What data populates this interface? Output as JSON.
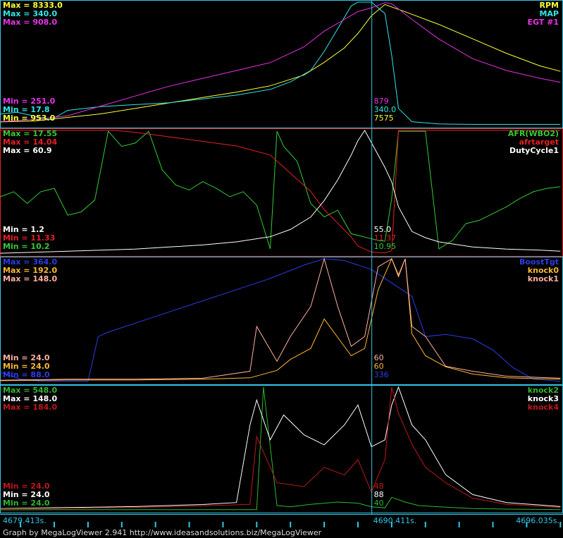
{
  "chart_data": [
    {
      "type": "line",
      "panel": 1,
      "legend": [
        {
          "name": "RPM",
          "color": "#ffff33"
        },
        {
          "name": "MAP",
          "color": "#33e6e6"
        },
        {
          "name": "EGT #1",
          "color": "#e633e6"
        }
      ],
      "max_labels": [
        "Max = 8333.0",
        "Max = 340.0",
        "Max = 908.0"
      ],
      "min_labels": [
        "Min = 251.0",
        "Min = 17.8",
        "Min = 953.0"
      ],
      "cursor_values": [
        "879",
        "340.0",
        "7575"
      ],
      "series": [
        {
          "name": "RPM",
          "color": "#ffff33",
          "x": [
            4679.4,
            4680.4,
            4681.4,
            4682.4,
            4683.4,
            4684.4,
            4685.4,
            4686.4,
            4687.4,
            4688.4,
            4689.0,
            4689.6,
            4690.0,
            4690.4,
            4690.8,
            4691.4,
            4692.4,
            4693.4,
            4694.4,
            4695.4,
            4696.0
          ],
          "y": [
            1700,
            1750,
            1950,
            2150,
            2450,
            2750,
            3050,
            3350,
            3700,
            4300,
            5000,
            5800,
            6600,
            7575,
            8200,
            7800,
            7100,
            6300,
            5500,
            4800,
            4500
          ]
        },
        {
          "name": "MAP",
          "color": "#33e6e6",
          "x": [
            4679.4,
            4679.9,
            4680.4,
            4680.9,
            4681.4,
            4682.4,
            4683.4,
            4684.4,
            4685.4,
            4686.4,
            4687.4,
            4688.0,
            4688.6,
            4689.0,
            4689.4,
            4689.8,
            4690.0,
            4690.4,
            4690.8,
            4691.0,
            4691.2,
            4691.6,
            4692.4,
            4693.4,
            4694.4,
            4695.4,
            4696.0
          ],
          "y": [
            45,
            50,
            40,
            30,
            55,
            65,
            70,
            75,
            85,
            95,
            110,
            130,
            160,
            210,
            270,
            330,
            340,
            340,
            310,
            200,
            60,
            25,
            19,
            18,
            18,
            18,
            18
          ]
        },
        {
          "name": "EGT #1",
          "color": "#e633e6",
          "x": [
            4679.4,
            4680.4,
            4681.4,
            4682.4,
            4683.4,
            4684.4,
            4685.4,
            4686.4,
            4687.4,
            4688.4,
            4689.0,
            4689.6,
            4690.0,
            4690.4,
            4690.8,
            4691.0,
            4691.6,
            4692.4,
            4693.4,
            4694.4,
            4695.4,
            4696.0
          ],
          "y": [
            300,
            310,
            330,
            380,
            430,
            480,
            520,
            560,
            600,
            680,
            760,
            820,
            860,
            879,
            905,
            900,
            820,
            720,
            620,
            560,
            520,
            500
          ]
        }
      ]
    },
    {
      "type": "line",
      "panel": 2,
      "legend": [
        {
          "name": "AFR(WBO2)",
          "color": "#33cc33"
        },
        {
          "name": "afrtarget",
          "color": "#e62020"
        },
        {
          "name": "DutyCycle1",
          "color": "#ffffff"
        }
      ],
      "max_labels": [
        "Max = 17.55",
        "Max = 14.04",
        "Max = 60.9"
      ],
      "min_labels": [
        "Min = 1.2",
        "Min = 11.33",
        "Min = 10.2"
      ],
      "cursor_values": [
        "55.0",
        "11.37",
        "10.95"
      ],
      "series": [
        {
          "name": "AFR(WBO2)",
          "color": "#33cc33",
          "x": [
            4679.4,
            4679.8,
            4680.2,
            4680.6,
            4681.0,
            4681.4,
            4681.8,
            4682.2,
            4682.6,
            4683.0,
            4683.4,
            4683.8,
            4684.2,
            4684.6,
            4685.0,
            4685.4,
            4685.8,
            4686.2,
            4686.6,
            4687.0,
            4687.4,
            4687.6,
            4687.8,
            4688.2,
            4688.6,
            4689.0,
            4689.4,
            4689.8,
            4690.2,
            4690.6,
            4690.8,
            4691.0,
            4691.2,
            4691.6,
            4692.0,
            4692.4,
            4692.8,
            4693.2,
            4693.6,
            4694.0,
            4694.4,
            4694.8,
            4695.2,
            4695.6,
            4696.0
          ],
          "y": [
            13.6,
            13.9,
            13.2,
            13.9,
            14.1,
            12.5,
            12.7,
            13.4,
            17.5,
            16.6,
            16.8,
            17.5,
            15.2,
            14.3,
            14.0,
            14.5,
            14.1,
            13.6,
            13.9,
            13.1,
            10.5,
            17.5,
            16.6,
            15.7,
            13.2,
            12.4,
            12.8,
            11.4,
            11.2,
            11.0,
            10.95,
            13.5,
            17.5,
            17.5,
            17.5,
            10.5,
            11.0,
            12.0,
            12.2,
            12.6,
            13.0,
            13.5,
            13.9,
            14.1,
            14.2
          ]
        },
        {
          "name": "afrtarget",
          "color": "#e62020",
          "x": [
            4679.4,
            4680.4,
            4681.4,
            4682.4,
            4682.8,
            4683.4,
            4684.4,
            4685.4,
            4686.4,
            4687.4,
            4688.0,
            4688.6,
            4689.0,
            4689.4,
            4689.8,
            4690.0,
            4690.4,
            4690.8,
            4691.0,
            4691.2,
            4691.6,
            4692.4,
            4693.4,
            4694.4,
            4695.4,
            4696.0
          ],
          "y": [
            17.5,
            17.5,
            17.5,
            17.5,
            15.6,
            14.0,
            13.9,
            13.8,
            13.7,
            13.5,
            13.1,
            12.7,
            12.3,
            12.0,
            11.7,
            11.5,
            11.37,
            11.35,
            11.4,
            17.5,
            17.5,
            17.5,
            17.5,
            17.5,
            17.5,
            17.5
          ]
        },
        {
          "name": "DutyCycle1",
          "color": "#ffffff",
          "x": [
            4679.4,
            4680.4,
            4681.4,
            4682.4,
            4683.4,
            4684.4,
            4685.4,
            4686.4,
            4687.4,
            4688.0,
            4688.6,
            4689.0,
            4689.4,
            4689.8,
            4690.0,
            4690.2,
            4690.4,
            4690.8,
            4691.0,
            4691.2,
            4691.6,
            4692.0,
            4692.4,
            4693.4,
            4694.4,
            4695.4,
            4696.0
          ],
          "y": [
            1.5,
            2.0,
            2.5,
            3.0,
            3.5,
            4.5,
            5.5,
            7.0,
            9.5,
            13.0,
            19.0,
            27.0,
            37.0,
            49.0,
            56.0,
            60.9,
            55.0,
            43.0,
            36.0,
            24.0,
            12.0,
            9.0,
            7.0,
            4.5,
            3.5,
            3.0,
            2.5
          ]
        }
      ]
    },
    {
      "type": "line",
      "panel": 3,
      "legend": [
        {
          "name": "BoostTgt",
          "color": "#2a3de6"
        },
        {
          "name": "knock0",
          "color": "#ffb833"
        },
        {
          "name": "knock1",
          "color": "#ffb0a0"
        }
      ],
      "max_labels": [
        "Max = 364.0",
        "Max = 192.0",
        "Max = 148.0"
      ],
      "min_labels": [
        "Min = 24.0",
        "Min = 24.0",
        "Min = 88.0"
      ],
      "cursor_values": [
        "60",
        "60",
        "336"
      ],
      "series": [
        {
          "name": "BoostTgt",
          "color": "#2a3de6",
          "x": [
            4679.4,
            4680.0,
            4680.6,
            4681.2,
            4682.0,
            4682.3,
            4682.6,
            4683.4,
            4684.0,
            4684.6,
            4685.4,
            4686.4,
            4687.4,
            4688.4,
            4689.0,
            4689.6,
            4690.4,
            4690.8,
            4691.2,
            4691.6,
            4692.0,
            4692.6,
            4693.4,
            4694.0,
            4694.6,
            4695.2,
            4696.0
          ],
          "y": [
            110,
            95,
            90,
            90,
            90,
            190,
            200,
            220,
            235,
            250,
            270,
            295,
            320,
            350,
            364,
            360,
            340,
            320,
            300,
            280,
            190,
            195,
            185,
            160,
            120,
            95,
            90
          ]
        },
        {
          "name": "knock0",
          "color": "#ffb833",
          "x": [
            4679.4,
            4681.4,
            4683.4,
            4685.4,
            4686.8,
            4687.6,
            4688.0,
            4688.6,
            4689.0,
            4689.4,
            4689.8,
            4690.2,
            4690.6,
            4691.0,
            4691.2,
            4691.4,
            4691.6,
            4692.0,
            4692.6,
            4693.4,
            4694.4,
            4696.0
          ],
          "y": [
            26,
            27,
            27,
            28,
            30,
            40,
            55,
            70,
            110,
            85,
            60,
            70,
            150,
            192,
            170,
            192,
            90,
            60,
            45,
            35,
            30,
            28
          ]
        },
        {
          "name": "knock1",
          "color": "#ffb0a0",
          "x": [
            4679.4,
            4681.4,
            4683.4,
            4685.4,
            4686.8,
            4687.0,
            4687.6,
            4688.0,
            4688.6,
            4689.0,
            4689.4,
            4689.8,
            4690.2,
            4690.6,
            4691.0,
            4691.2,
            4691.4,
            4691.6,
            4692.0,
            4692.6,
            4693.4,
            4694.4,
            4696.0
          ],
          "y": [
            26,
            27,
            27,
            28,
            35,
            80,
            45,
            70,
            100,
            148,
            100,
            60,
            70,
            140,
            148,
            130,
            148,
            80,
            70,
            40,
            35,
            30,
            28
          ]
        }
      ]
    },
    {
      "type": "line",
      "panel": 4,
      "legend": [
        {
          "name": "knock2",
          "color": "#2db82d"
        },
        {
          "name": "knock3",
          "color": "#ffffff"
        },
        {
          "name": "knock4",
          "color": "#c01818"
        }
      ],
      "max_labels": [
        "Max = 548.0",
        "Max = 148.0",
        "Max = 184.0"
      ],
      "min_labels": [
        "Min = 24.0",
        "Min = 24.0",
        "Min = 24.0"
      ],
      "cursor_values": [
        "48",
        "88",
        "40"
      ],
      "series": [
        {
          "name": "knock2",
          "color": "#2db82d",
          "x": [
            4679.4,
            4681.4,
            4683.4,
            4685.4,
            4687.0,
            4687.2,
            4687.6,
            4688.0,
            4688.6,
            4689.4,
            4690.0,
            4690.4,
            4690.8,
            4691.0,
            4691.4,
            4691.8,
            4692.4,
            4693.4,
            4694.4,
            4696.0
          ],
          "y": [
            27,
            28,
            28,
            28,
            28,
            548,
            45,
            40,
            50,
            60,
            55,
            40,
            35,
            80,
            60,
            45,
            40,
            32,
            30,
            28
          ]
        },
        {
          "name": "knock3",
          "color": "#ffffff",
          "x": [
            4679.4,
            4681.4,
            4683.4,
            4685.4,
            4686.4,
            4686.8,
            4687.0,
            4687.4,
            4687.8,
            4688.4,
            4689.0,
            4689.6,
            4690.0,
            4690.4,
            4690.8,
            4691.0,
            4691.2,
            4691.6,
            4692.0,
            4692.6,
            4693.4,
            4694.4,
            4696.0
          ],
          "y": [
            26,
            27,
            28,
            30,
            32,
            110,
            135,
            95,
            120,
            100,
            90,
            110,
            130,
            88,
            95,
            130,
            148,
            110,
            95,
            60,
            40,
            32,
            28
          ]
        },
        {
          "name": "knock4",
          "color": "#c01818",
          "x": [
            4679.4,
            4681.4,
            4683.4,
            4685.4,
            4686.8,
            4687.0,
            4687.6,
            4688.4,
            4689.0,
            4689.6,
            4690.0,
            4690.4,
            4690.8,
            4691.0,
            4691.2,
            4691.6,
            4692.0,
            4692.6,
            4693.4,
            4694.4,
            4696.0
          ],
          "y": [
            26,
            27,
            28,
            30,
            32,
            120,
            60,
            55,
            80,
            70,
            90,
            48,
            90,
            184,
            150,
            110,
            80,
            60,
            40,
            32,
            28
          ]
        }
      ]
    }
  ],
  "axis": {
    "x_min": 4679.413,
    "x_max": 4696.035,
    "cursor_x": 4690.411,
    "start_label": "4679.413s.",
    "cursor_label": "4690.411s.",
    "end_label": "4696.035s.",
    "label_color": "#33c6e6"
  },
  "footer": "Graph by MegaLogViewer 2.941 http://www.ideasandsolutions.biz/MegaLogViewer"
}
